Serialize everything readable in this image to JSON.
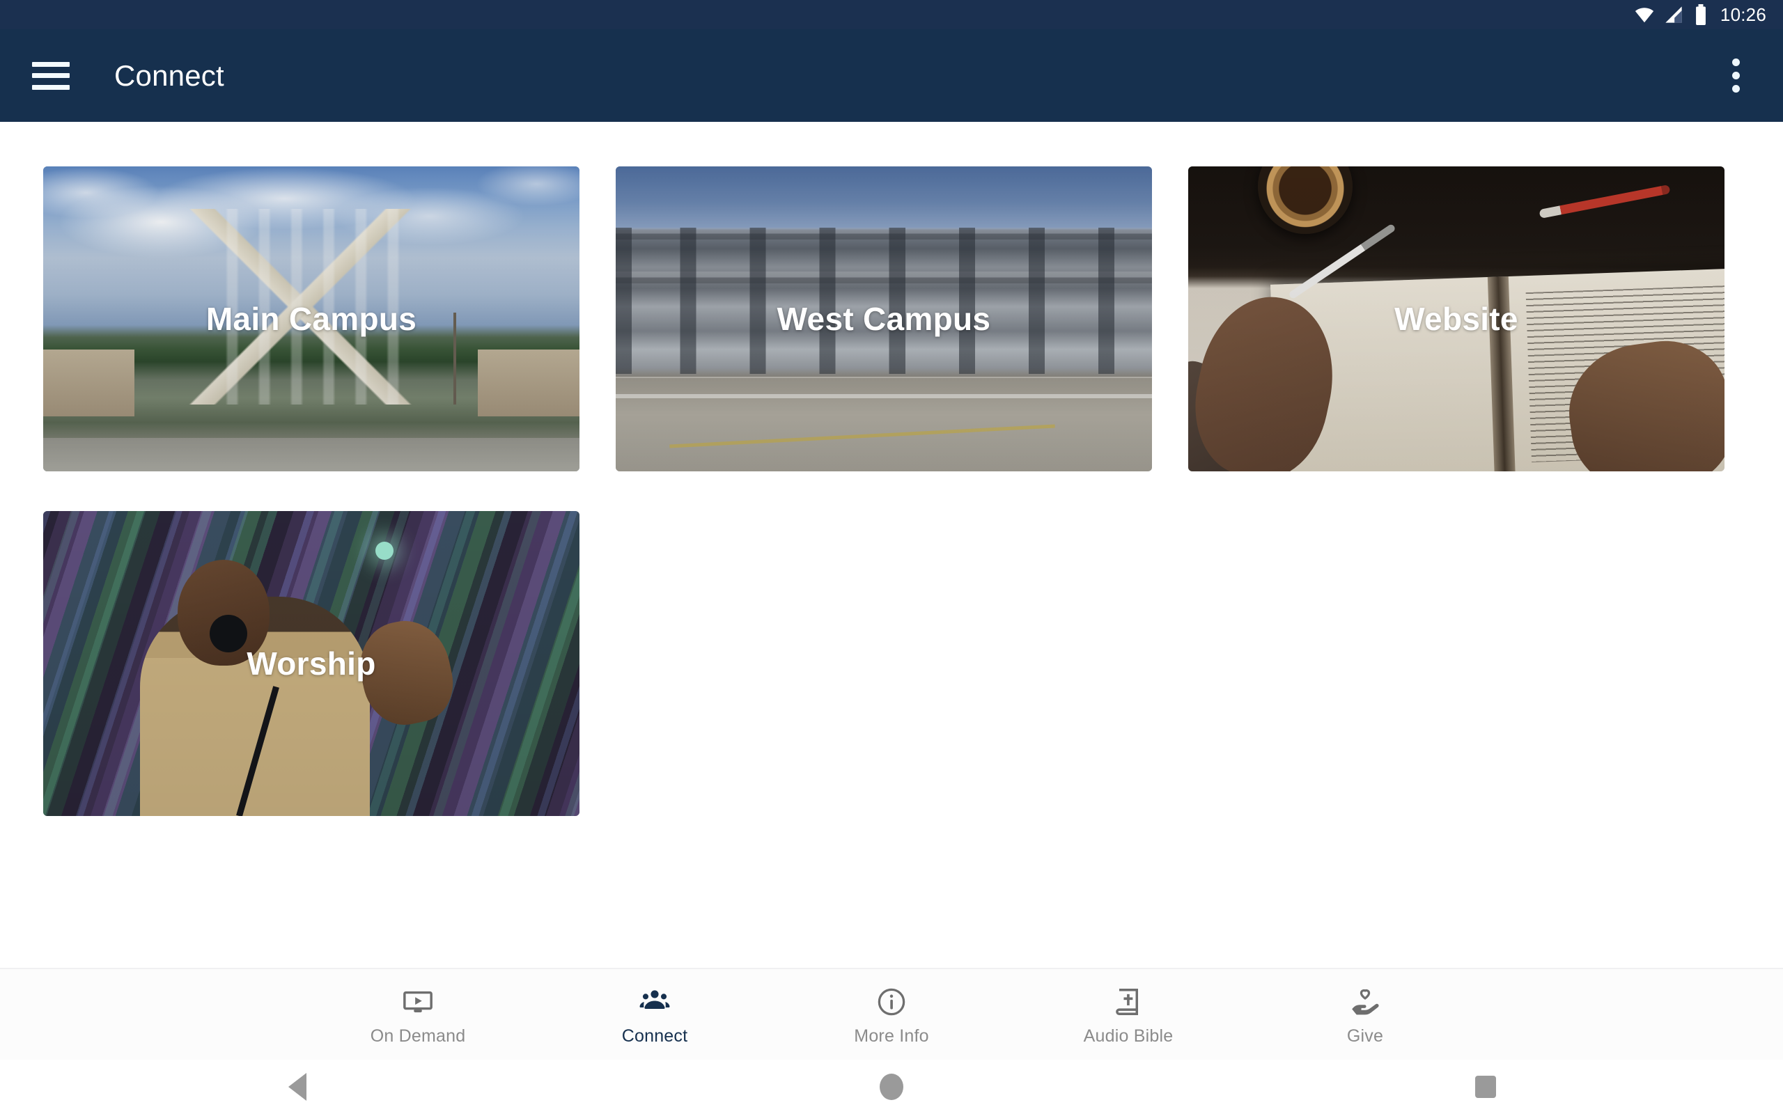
{
  "status_bar": {
    "time": "10:26",
    "icons": [
      "wifi-icon",
      "cellular-signal-icon",
      "battery-icon"
    ]
  },
  "app_bar": {
    "menu_icon": "hamburger-menu-icon",
    "title": "Connect",
    "overflow_icon": "more-vert-icon",
    "background_color": "#16304e"
  },
  "content": {
    "cards": [
      {
        "label": "Main Campus",
        "art": "church-building-exterior"
      },
      {
        "label": "West Campus",
        "art": "modern-campus-building"
      },
      {
        "label": "Website",
        "art": "open-bible-with-hands-and-coffee"
      },
      {
        "label": "Worship",
        "art": "singer-on-stage-with-microphone"
      }
    ]
  },
  "bottom_nav": {
    "active": "Connect",
    "active_color": "#16304e",
    "inactive_color": "#8b8b8b",
    "items": [
      {
        "label": "On Demand",
        "icon": "ondemand-video-icon"
      },
      {
        "label": "Connect",
        "icon": "groups-people-icon"
      },
      {
        "label": "More Info",
        "icon": "info-circle-icon"
      },
      {
        "label": "Audio Bible",
        "icon": "bible-book-cross-icon"
      },
      {
        "label": "Give",
        "icon": "hand-holding-heart-icon"
      }
    ]
  },
  "system_nav": {
    "buttons": [
      {
        "name": "back-button",
        "icon": "triangle-back-icon"
      },
      {
        "name": "home-button",
        "icon": "circle-home-icon"
      },
      {
        "name": "recents-button",
        "icon": "square-recents-icon"
      }
    ]
  }
}
